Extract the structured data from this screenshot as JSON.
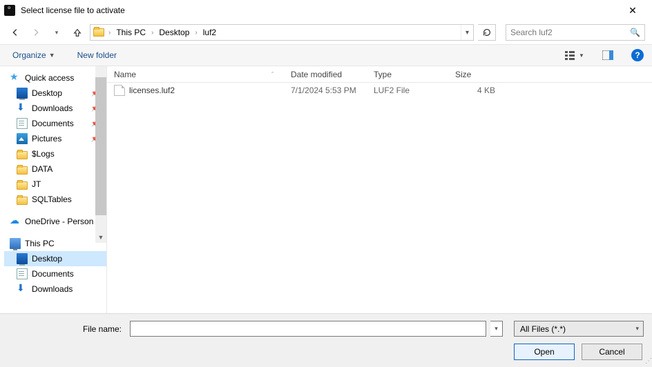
{
  "title": "Select license file to activate",
  "breadcrumb": [
    "This PC",
    "Desktop",
    "luf2"
  ],
  "search_placeholder": "Search luf2",
  "toolbar": {
    "organize": "Organize",
    "new_folder": "New folder"
  },
  "columns": {
    "name": "Name",
    "date": "Date modified",
    "type": "Type",
    "size": "Size"
  },
  "files": [
    {
      "name": "licenses.luf2",
      "date": "7/1/2024 5:53 PM",
      "type": "LUF2 File",
      "size": "4 KB"
    }
  ],
  "sidebar": {
    "quick_access": "Quick access",
    "items_pinned": [
      {
        "label": "Desktop",
        "icon": "desktop"
      },
      {
        "label": "Downloads",
        "icon": "download"
      },
      {
        "label": "Documents",
        "icon": "doc"
      },
      {
        "label": "Pictures",
        "icon": "pic"
      }
    ],
    "items_recent": [
      {
        "label": "$Logs",
        "icon": "folder"
      },
      {
        "label": "DATA",
        "icon": "folder"
      },
      {
        "label": "JT",
        "icon": "folder"
      },
      {
        "label": "SQLTables",
        "icon": "folder"
      }
    ],
    "onedrive": "OneDrive - Person",
    "this_pc": "This PC",
    "pc_items": [
      {
        "label": "Desktop",
        "icon": "desktop",
        "selected": true
      },
      {
        "label": "Documents",
        "icon": "doc"
      },
      {
        "label": "Downloads",
        "icon": "download"
      }
    ]
  },
  "footer": {
    "filename_label": "File name:",
    "filename_value": "",
    "filter": "All Files (*.*)",
    "open": "Open",
    "cancel": "Cancel"
  }
}
